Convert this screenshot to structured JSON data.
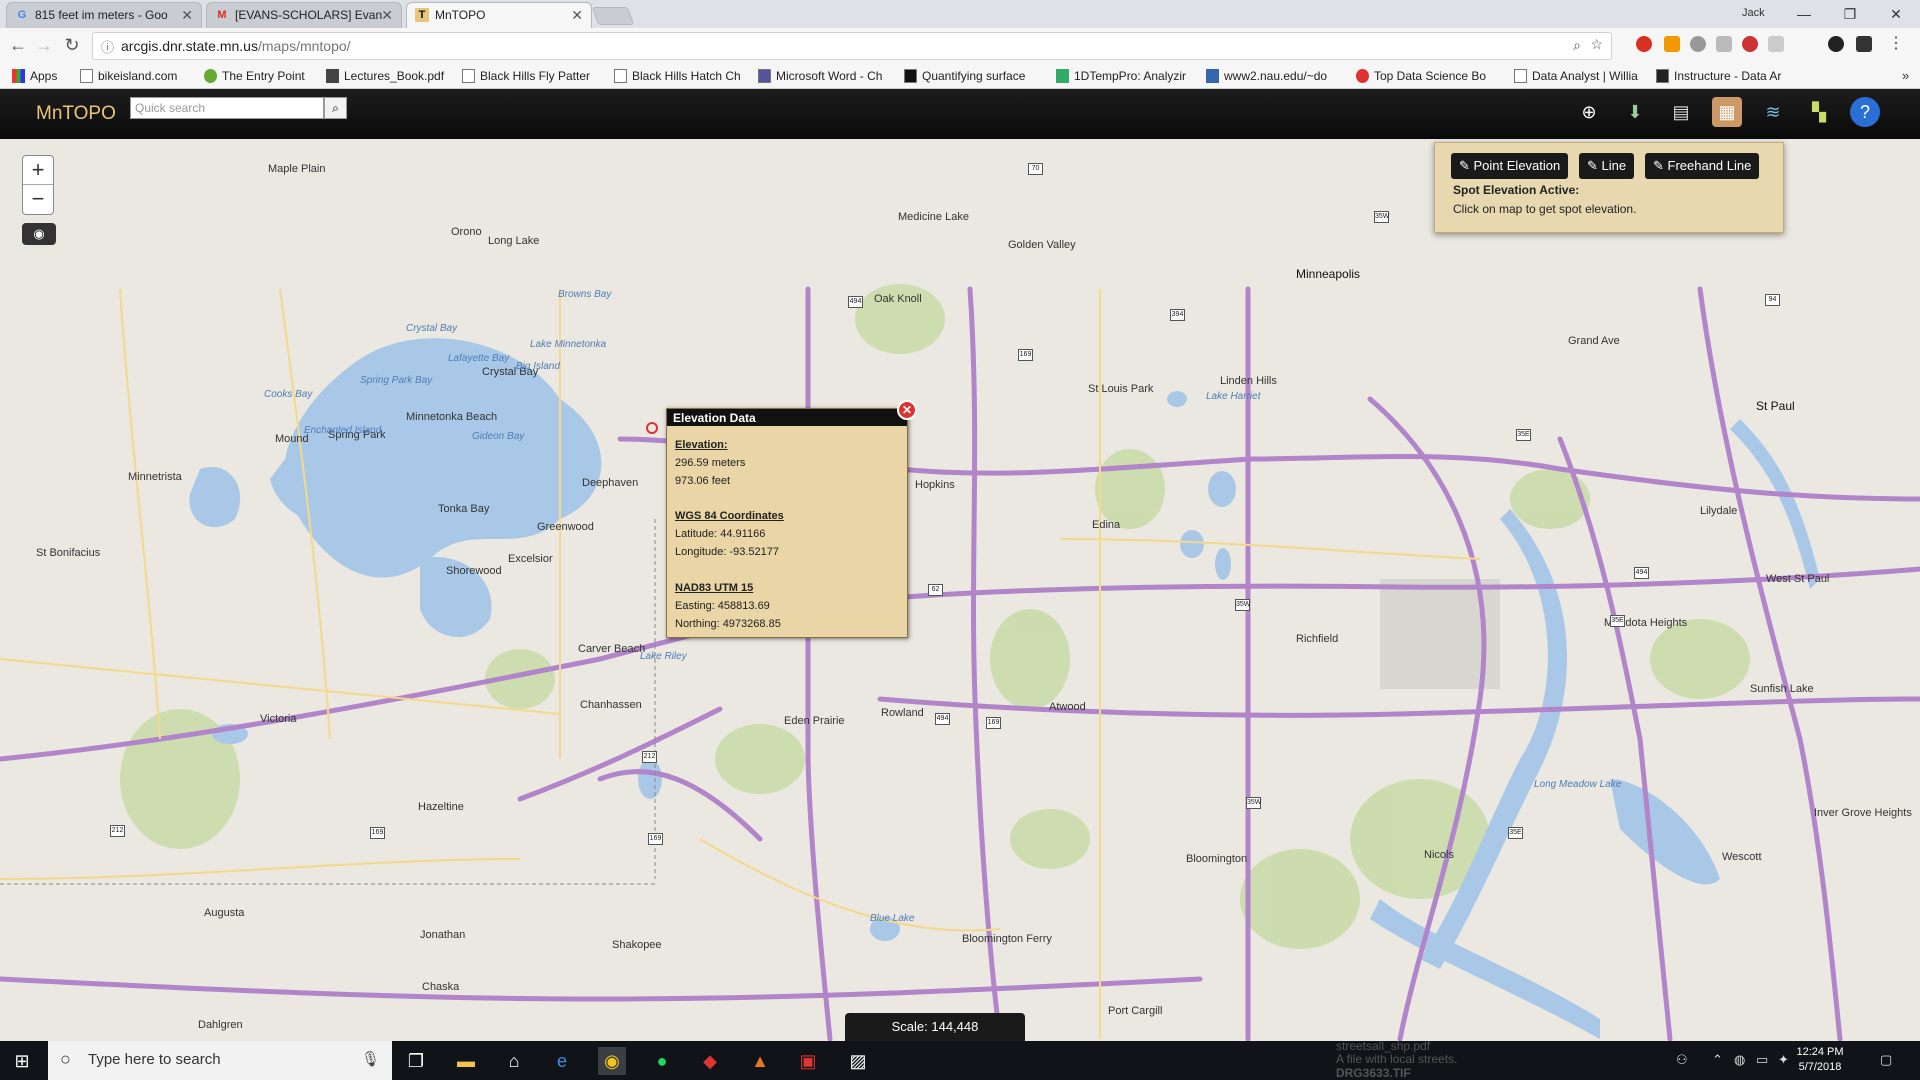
{
  "browser": {
    "tabs": [
      {
        "title": "815 feet im meters - Goo",
        "favicon": "G"
      },
      {
        "title": "[EVANS-SCHOLARS] Evan",
        "favicon": "M"
      },
      {
        "title": "MnTOPO",
        "favicon": "T"
      }
    ],
    "user": "Jack",
    "url_host": "arcgis.dnr.state.mn.us",
    "url_path": "/maps/mntopo/",
    "bookmarks": [
      "Apps",
      "bikeisland.com",
      "The Entry Point",
      "Lectures_Book.pdf",
      "Black Hills Fly Patter",
      "Black Hills Hatch Ch",
      "Microsoft Word - Ch",
      "Quantifying surface",
      "1DTempPro: Analyzir",
      "www2.nau.edu/~do",
      "Top Data Science Bo",
      "Data Analyst | Willia",
      "Instructure - Data Ar"
    ]
  },
  "app": {
    "title": "MnTOPO",
    "search_placeholder": "Quick search"
  },
  "tools": {
    "point_elevation": "Point Elevation",
    "line": "Line",
    "freehand_line": "Freehand Line",
    "status_title": "Spot Elevation Active:",
    "status_text": "Click on map to get spot elevation."
  },
  "popup": {
    "title": "Elevation Data",
    "elevation_heading": "Elevation:",
    "meters": "296.59 meters",
    "feet": "973.06 feet",
    "wgs_heading": "WGS 84 Coordinates",
    "latitude": "Latitude: 44.91166",
    "longitude": "Longitude: -93.52177",
    "nad_heading": "NAD83 UTM 15",
    "easting": "Easting: 458813.69",
    "northing": "Northing: 4973268.85"
  },
  "map": {
    "scale": "Scale: 144,448",
    "places": [
      "Maple Plain",
      "Medicine Lake",
      "Golden Valley",
      "Minneapolis",
      "Oak Knoll",
      "Long Lake",
      "Orono",
      "Crystal Bay",
      "Minnetonka Beach",
      "Spring Park",
      "Mound",
      "Minnetrista",
      "Tonka Bay",
      "Greenwood",
      "Deephaven",
      "Excelsior",
      "Shorewood",
      "St Bonifacius",
      "Carver Beach",
      "Chanhassen",
      "Victoria",
      "Hazeltine",
      "Eden Prairie",
      "Rowland",
      "Hopkins",
      "St Louis Park",
      "Edina",
      "Richfield",
      "Atwood",
      "Bloomington",
      "Nicols",
      "St Paul",
      "Lilydale",
      "West St Paul",
      "Mendota Heights",
      "Sunfish Lake",
      "Inver Grove Heights",
      "Wescott",
      "Augusta",
      "Jonathan",
      "Shakopee",
      "Chaska",
      "Dahlgren",
      "Bloomington Ferry",
      "Port Cargill",
      "Grand Ave",
      "Linden Hills"
    ],
    "lakes": [
      "Lake Minnetonka",
      "Browns Bay",
      "Crystal Bay",
      "Lafayette Bay",
      "Big Island",
      "Cooks Bay",
      "Spring Park Bay",
      "Enchanted Island",
      "Gideon Bay",
      "Lake Harriet",
      "Lake Riley",
      "Blue Lake",
      "Long Meadow Lake"
    ]
  },
  "taskbar": {
    "search_placeholder": "Type here to search",
    "time": "12:24 PM",
    "date": "5/7/2018",
    "ghost_lines": [
      "streetsall_shp.pdf",
      "A file with local streets.",
      "DRG3633.TIF"
    ]
  },
  "colors": {
    "highway": "#b284c9",
    "water": "#a9c8e8",
    "park": "#c8dba6",
    "popup_bg": "#e9d5a5",
    "accent": "#e8c57a"
  }
}
